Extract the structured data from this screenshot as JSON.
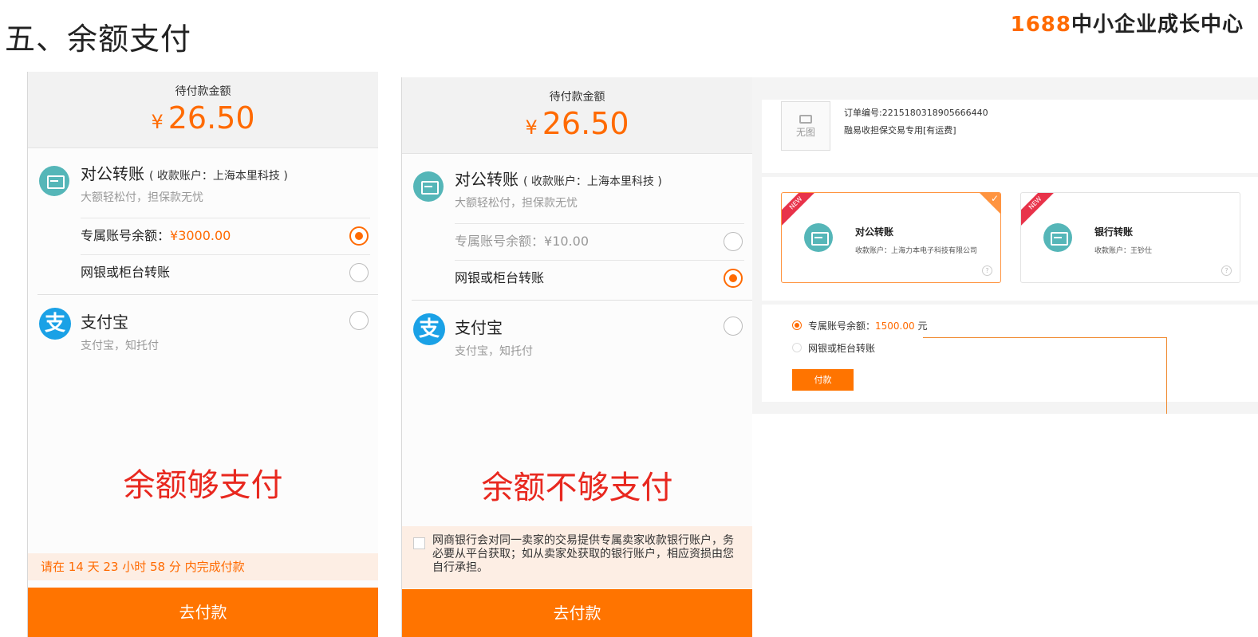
{
  "slide_title": "五、余额支付",
  "brand": {
    "num": "1688",
    "text": "中小企业成长中心"
  },
  "panel_a": {
    "amount_label": "待付款金额",
    "currency": "¥",
    "amount": "26.50",
    "corp_title": "对公转账",
    "corp_account": "( 收款账户：上海本里科技 )",
    "corp_sub": "大额轻松付，担保款无忧",
    "balance_label": "专属账号余额：",
    "balance_value": "¥3000.00",
    "bank_option": "网银或柜台转账",
    "alipay_title": "支付宝",
    "alipay_sub": "支付宝，知托付",
    "caption": "余额够支付",
    "deadline": "请在 14 天 23 小时 58 分 内完成付款",
    "pay_button": "去付款"
  },
  "panel_b": {
    "amount_label": "待付款金额",
    "currency": "¥",
    "amount": "26.50",
    "corp_title": "对公转账",
    "corp_account": "( 收款账户：上海本里科技 )",
    "corp_sub": "大额轻松付，担保款无忧",
    "balance_label": "专属账号余额：",
    "balance_value": "¥10.00",
    "bank_option": "网银或柜台转账",
    "alipay_title": "支付宝",
    "alipay_sub": "支付宝，知托付",
    "caption": "余额不够支付",
    "notice": "网商银行会对同一卖家的交易提供专属卖家收款银行账户，务必要从平台获取；如从卖家处获取的银行账户，相应资损由您自行承担。",
    "pay_button": "去付款"
  },
  "desktop": {
    "no_image": "无图",
    "order_no": "订单编号:2215180318905666440",
    "order_desc": "融易收担保交易专用[有运费]",
    "card1_badge": "NEW",
    "card1_title": "对公转账",
    "card1_sub": "收款账户：上海力本电子科技有限公司",
    "card2_badge": "NEW",
    "card2_title": "银行转账",
    "card2_sub": "收款账户：王钞仕",
    "help": "?",
    "balance_label": "专属账号余额：",
    "balance_value": "1500.00",
    "balance_unit": " 元",
    "bank_option": "网银或柜台转账",
    "pay_button": "付款"
  },
  "colors": {
    "accent": "#ff6a00",
    "button": "#ff7400",
    "caption": "#e8281f",
    "teal": "#55b6b8",
    "alipay": "#1aa1e6"
  }
}
